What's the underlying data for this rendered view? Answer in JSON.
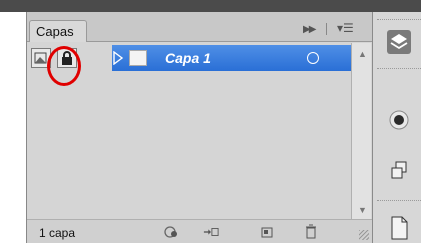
{
  "panel": {
    "tab_label": "Capas",
    "collapse_icon": "double-chevron-right-icon",
    "menu_icon": "panel-menu-icon"
  },
  "layer": {
    "name": "Capa 1",
    "visibility_icon": "triangle-right-icon",
    "target_icon": "target-circle-icon"
  },
  "lock_icons": [
    "lock-transparent-icon",
    "lock-all-icon"
  ],
  "footer": {
    "count_label": "1 capa",
    "buttons": [
      "link-layers-icon",
      "new-group-icon",
      "new-layer-icon",
      "trash-icon"
    ]
  },
  "right_dock": {
    "buttons": [
      "layers-icon",
      "radio-circle-icon",
      "stack-icon",
      "document-icon"
    ]
  },
  "colors": {
    "highlight": "#3a7fe3",
    "annotation": "#e00000"
  }
}
